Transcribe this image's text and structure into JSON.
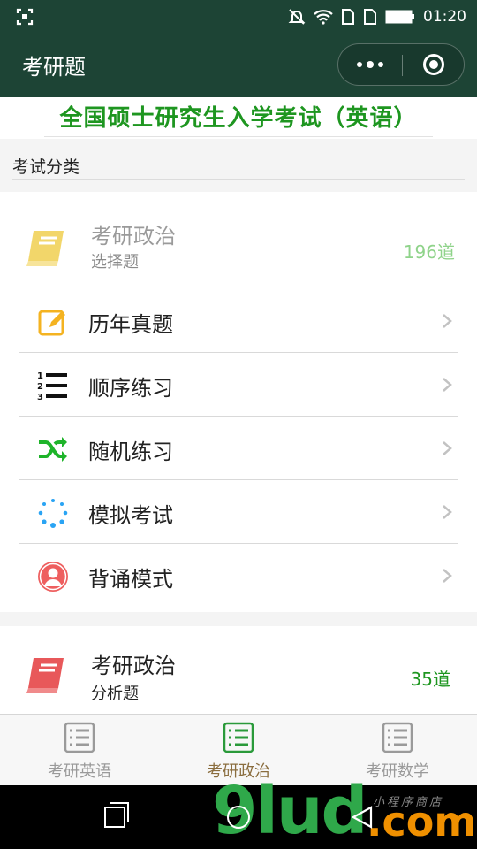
{
  "status_bar": {
    "time": "01:20"
  },
  "navbar": {
    "title": "考研题"
  },
  "content": {
    "exam_title": "全国硕士研究生入学考试（英语）",
    "category_label": "考试分类",
    "subjects": [
      {
        "name": "考研政治",
        "type": "选择题",
        "count": "196道",
        "icon": "book-icon",
        "color": "#f2d66a"
      },
      {
        "name": "考研政治",
        "type": "分析题",
        "count": "35道",
        "icon": "book-icon",
        "color": "#e8585a"
      }
    ],
    "menu": [
      {
        "label": "历年真题",
        "icon": "edit-icon"
      },
      {
        "label": "顺序练习",
        "icon": "numbered-list-icon"
      },
      {
        "label": "随机练习",
        "icon": "shuffle-icon"
      },
      {
        "label": "模拟考试",
        "icon": "loading-dots-icon"
      },
      {
        "label": "背诵模式",
        "icon": "user-icon"
      }
    ]
  },
  "tabbar": {
    "tabs": [
      {
        "label": "考研英语",
        "active": false
      },
      {
        "label": "考研政治",
        "active": true
      },
      {
        "label": "考研数学",
        "active": false
      }
    ]
  },
  "watermark": {
    "main": "9lud",
    "tld": ".com",
    "sub": "小程序商店"
  },
  "colors": {
    "header": "#1d4435",
    "accent_green": "#1e9620",
    "tab_active": "#8a6d3e"
  }
}
